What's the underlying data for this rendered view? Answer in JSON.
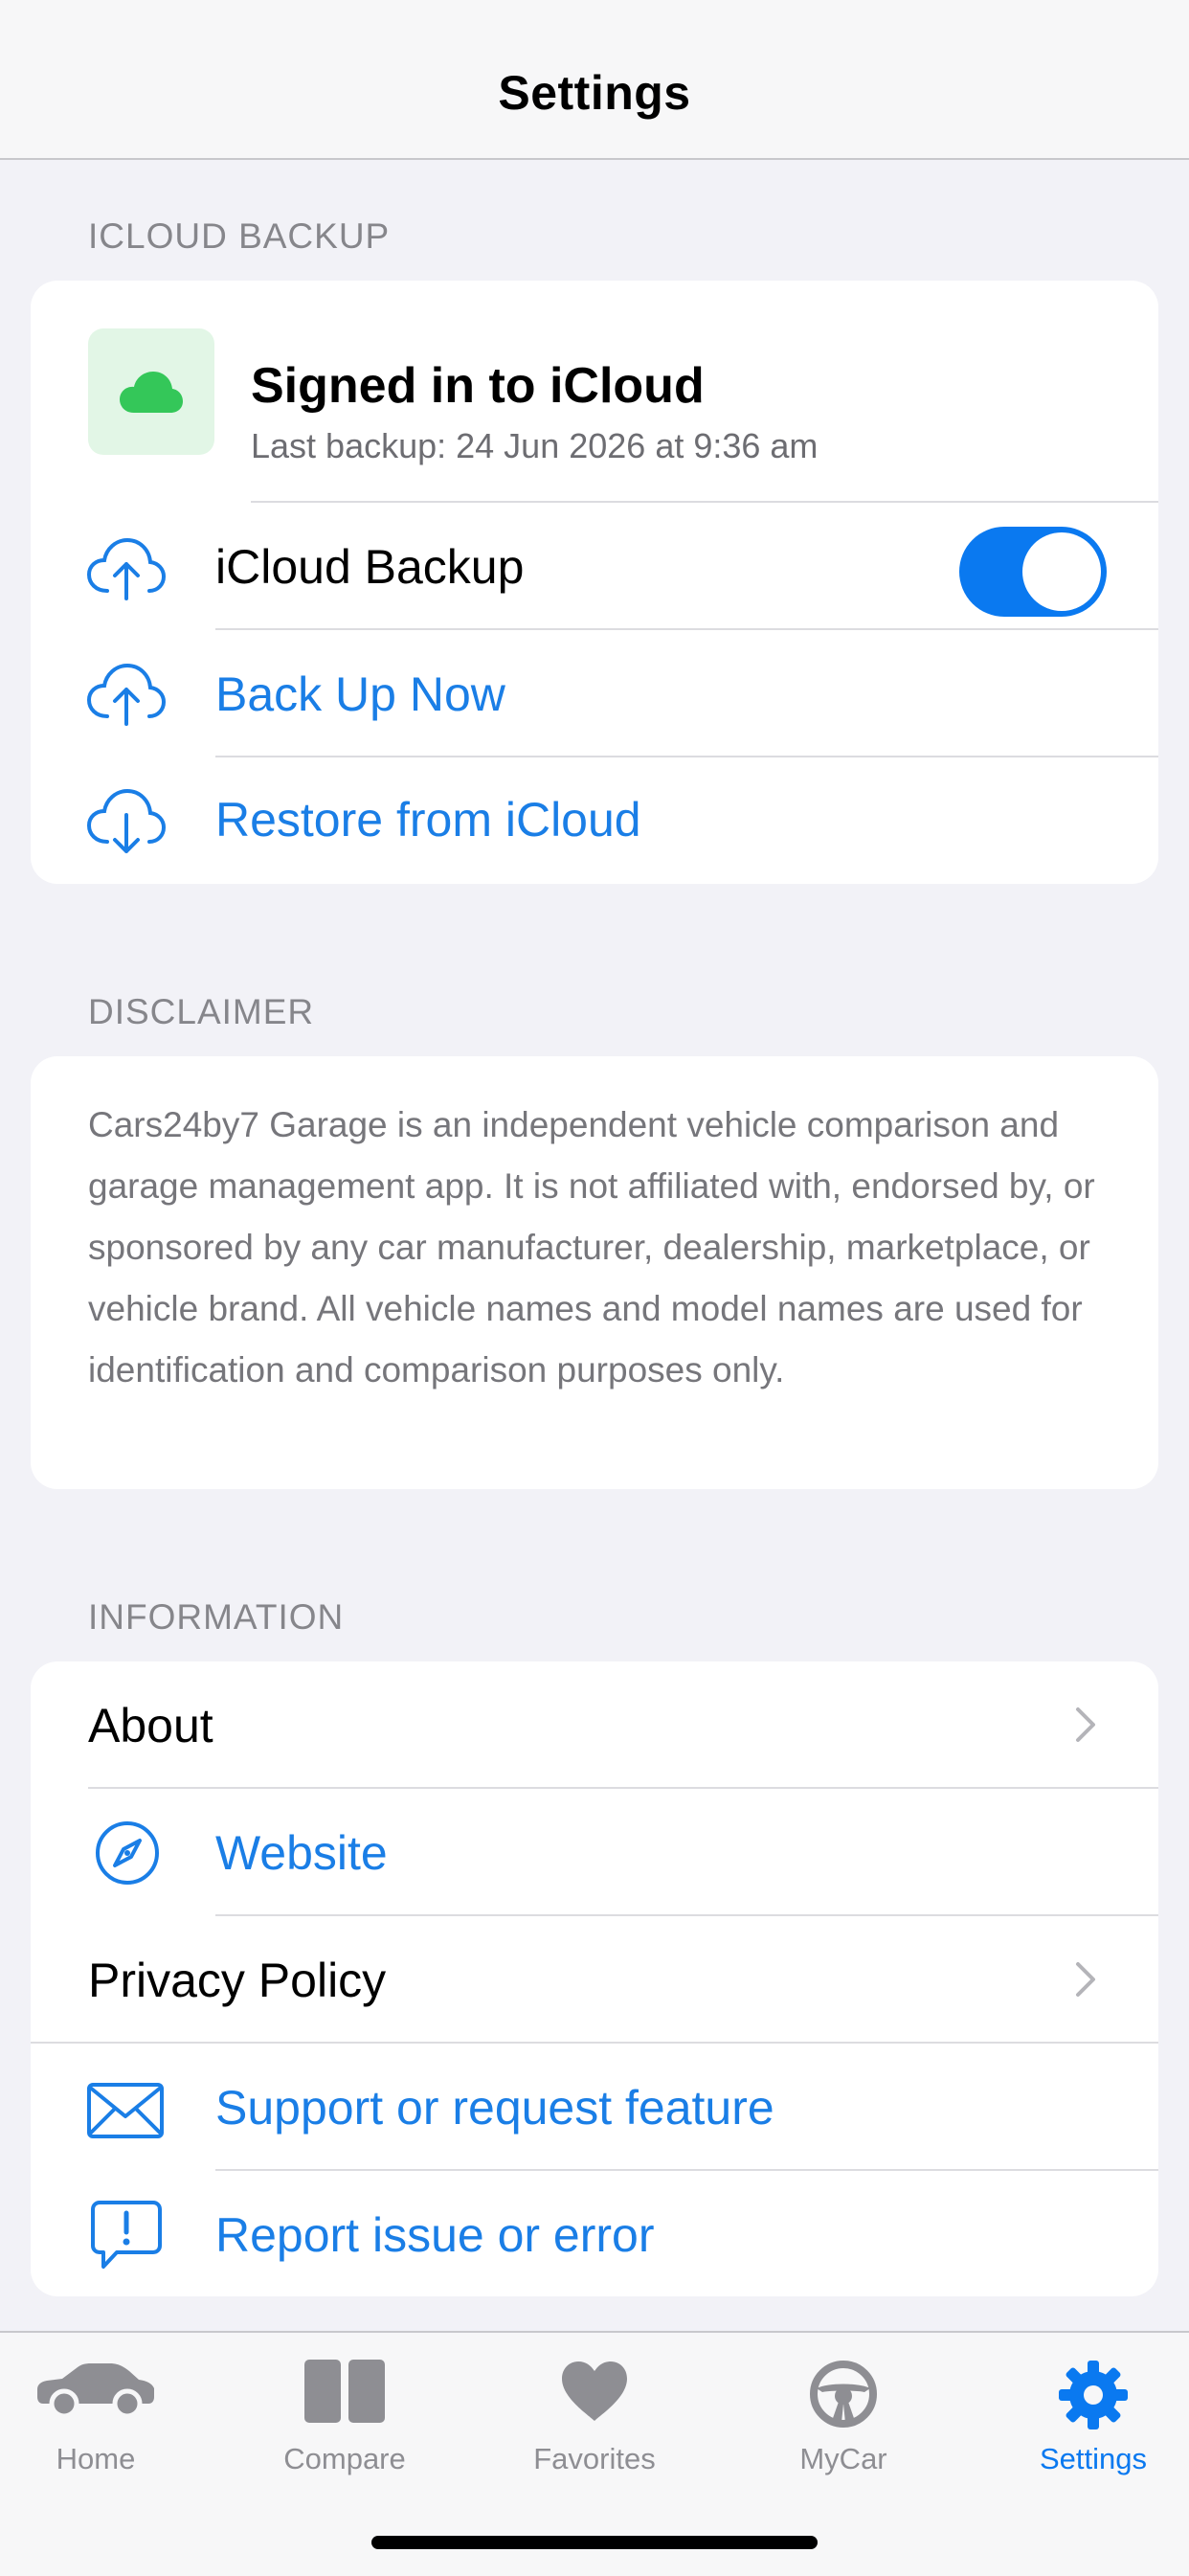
{
  "nav": {
    "title": "Settings"
  },
  "icloud": {
    "header": "ICLOUD BACKUP",
    "status_title": "Signed in to iCloud",
    "last_backup": "Last backup: 24 Jun 2026 at 9:36 am",
    "backup_toggle_label": "iCloud Backup",
    "backup_enabled": true,
    "back_up_now": "Back Up Now",
    "restore": "Restore from iCloud"
  },
  "disclaimer": {
    "header": "DISCLAIMER",
    "text": "Cars24by7 Garage is an independent vehicle comparison and garage management app. It is not affiliated with, endorsed by, or sponsored by any car manufacturer, dealership, marketplace, or vehicle brand. All vehicle names and model names are used for identification and comparison purposes only."
  },
  "information": {
    "header": "INFORMATION",
    "items": [
      {
        "label": "About",
        "icon": "chevron-right-icon"
      },
      {
        "label": "Website",
        "icon": "compass-icon"
      },
      {
        "label": "Privacy Policy",
        "icon": "chevron-right-icon"
      },
      {
        "label": "Support or request feature",
        "icon": "envelope-icon"
      },
      {
        "label": "Report issue or error",
        "icon": "exclamation-bubble-icon"
      }
    ]
  },
  "tabs": [
    {
      "label": "Home",
      "icon": "car-icon",
      "active": false
    },
    {
      "label": "Compare",
      "icon": "split-squares-icon",
      "active": false
    },
    {
      "label": "Favorites",
      "icon": "heart-icon",
      "active": false
    },
    {
      "label": "MyCar",
      "icon": "steering-wheel-icon",
      "active": false
    },
    {
      "label": "Settings",
      "icon": "gear-icon",
      "active": true
    }
  ],
  "colors": {
    "accent": "#0a79f0",
    "link": "#1a7ee6",
    "cloud_green": "#34c759",
    "background": "#f2f2f7"
  }
}
